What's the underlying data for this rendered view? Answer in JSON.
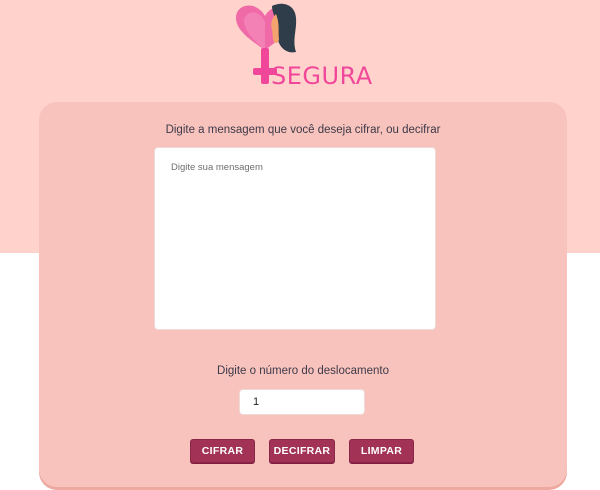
{
  "header": {
    "logo_text": "SEGURA",
    "colors": {
      "brand_pink": "#f0479a",
      "hair": "#2f3d4a",
      "band": "#ffd3cc"
    }
  },
  "form": {
    "prompt": "Digite a mensagem que você deseja cifrar, ou decifrar",
    "message_placeholder": "Digite sua mensagem",
    "message_value": "",
    "shift_label": "Digite o número do deslocamento",
    "shift_value": "1"
  },
  "buttons": {
    "encrypt": "CIFRAR",
    "decrypt": "DECIFRAR",
    "clear": "LIMPAR"
  },
  "colors": {
    "card": "#f8c3bc",
    "button": "#a23256",
    "text": "#3d3a4a"
  }
}
